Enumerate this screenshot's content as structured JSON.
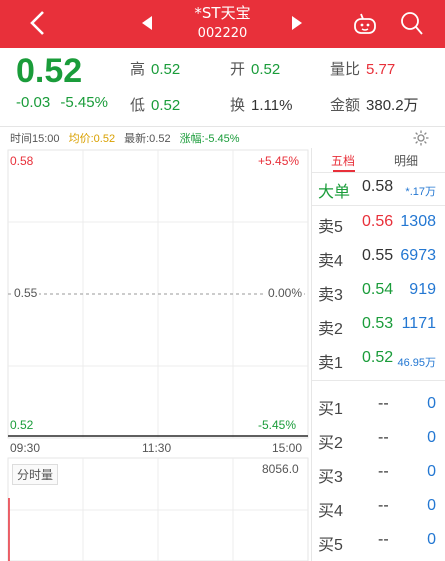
{
  "header": {
    "name": "*ST天宝",
    "code": "002220",
    "bg_color": "#e8303a"
  },
  "quote": {
    "price": "0.52",
    "change": "-0.03",
    "change_pct": "-5.45%",
    "high_label": "高",
    "high": "0.52",
    "open_label": "开",
    "open": "0.52",
    "volume_ratio_label": "量比",
    "volume_ratio": "5.77",
    "low_label": "低",
    "low": "0.52",
    "turnover_label": "换",
    "turnover": "1.11%",
    "amount_label": "金额",
    "amount": "380.2万"
  },
  "info_bar": {
    "time": "时间15:00",
    "avg": "均价:0.52",
    "latest": "最新:0.52",
    "change": "涨幅:-5.45%"
  },
  "chart": {
    "y_top": "0.58",
    "y_mid": "0.55",
    "y_bottom": "0.52",
    "pct_top": "+5.45%",
    "pct_mid": "0.00%",
    "pct_bottom": "-5.45%",
    "t_start": "09:30",
    "t_mid": "11:30",
    "t_end": "15:00",
    "volume_label": "分时量",
    "volume_max": "8056.0"
  },
  "chart_data": {
    "type": "line",
    "x": [
      "09:30",
      "11:30",
      "15:00"
    ],
    "series": [
      {
        "values": [
          0.52,
          0.52,
          0.52
        ]
      }
    ],
    "ylim": [
      0.52,
      0.58
    ],
    "ylabel": "",
    "xlabel": "",
    "volume_max": 8056.0
  },
  "tabs": {
    "five_level": "五档",
    "detail": "明细"
  },
  "order_book": {
    "big": {
      "label": "大单",
      "price": "0.58",
      "vol": "*.17万"
    },
    "asks": [
      {
        "label": "卖5",
        "price": "0.56",
        "vol": "1308",
        "color": "red"
      },
      {
        "label": "卖4",
        "price": "0.55",
        "vol": "6973",
        "color": "dark"
      },
      {
        "label": "卖3",
        "price": "0.54",
        "vol": "919",
        "color": "green"
      },
      {
        "label": "卖2",
        "price": "0.53",
        "vol": "1171",
        "color": "green"
      },
      {
        "label": "卖1",
        "price": "0.52",
        "vol": "46.95万",
        "color": "green"
      }
    ],
    "bids": [
      {
        "label": "买1",
        "price": "--",
        "vol": "0"
      },
      {
        "label": "买2",
        "price": "--",
        "vol": "0"
      },
      {
        "label": "买3",
        "price": "--",
        "vol": "0"
      },
      {
        "label": "买4",
        "price": "--",
        "vol": "0"
      },
      {
        "label": "买5",
        "price": "--",
        "vol": "0"
      }
    ]
  },
  "icons": [
    "back-icon",
    "prev-stock-icon",
    "next-stock-icon",
    "robot-icon",
    "search-icon",
    "settings-gear-icon"
  ]
}
